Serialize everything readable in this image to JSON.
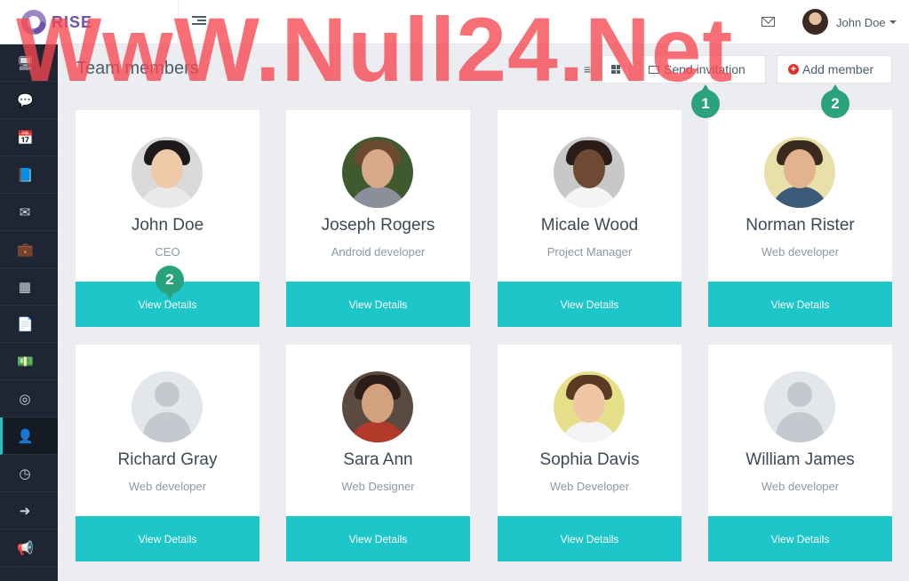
{
  "app": {
    "name": "RISE"
  },
  "topbar": {
    "user_name": "John Doe"
  },
  "page": {
    "title": "Team members",
    "send_invitation": "Send invitation",
    "add_member": "Add member"
  },
  "markers": {
    "m1": "1",
    "m2": "2",
    "m3": "2"
  },
  "sidebar": {
    "items": [
      {
        "icon": "dashboard-icon",
        "glyph": "🖥"
      },
      {
        "icon": "chat-icon",
        "glyph": "💬"
      },
      {
        "icon": "calendar-icon",
        "glyph": "📅"
      },
      {
        "icon": "book-icon",
        "glyph": "📘"
      },
      {
        "icon": "envelope-icon",
        "glyph": "✉"
      },
      {
        "icon": "briefcase-icon",
        "glyph": "💼"
      },
      {
        "icon": "grid-icon",
        "glyph": "▦"
      },
      {
        "icon": "file-icon",
        "glyph": "📄"
      },
      {
        "icon": "money-icon",
        "glyph": "💵"
      },
      {
        "icon": "lifebuoy-icon",
        "glyph": "◎"
      },
      {
        "icon": "user-icon",
        "glyph": "👤"
      },
      {
        "icon": "clock-icon",
        "glyph": "◷"
      },
      {
        "icon": "sign-out-icon",
        "glyph": "➜"
      },
      {
        "icon": "bullhorn-icon",
        "glyph": "📢"
      }
    ]
  },
  "members": [
    {
      "name": "John Doe",
      "role": "CEO",
      "button": "View Details"
    },
    {
      "name": "Joseph Rogers",
      "role": "Android developer",
      "button": "View Details"
    },
    {
      "name": "Micale Wood",
      "role": "Project Manager",
      "button": "View Details"
    },
    {
      "name": "Norman Rister",
      "role": "Web developer",
      "button": "View Details"
    },
    {
      "name": "Richard Gray",
      "role": "Web developer",
      "button": "View Details"
    },
    {
      "name": "Sara Ann",
      "role": "Web Designer",
      "button": "View Details"
    },
    {
      "name": "Sophia Davis",
      "role": "Web Developer",
      "button": "View Details"
    },
    {
      "name": "William James",
      "role": "Web developer",
      "button": "View Details"
    }
  ],
  "watermark": {
    "text": "WwW.Null24.Net"
  },
  "colors": {
    "accent": "#1dc6c9",
    "sidebar": "#1e2633",
    "marker": "#2aa27c",
    "brand": "#6a55a8"
  }
}
